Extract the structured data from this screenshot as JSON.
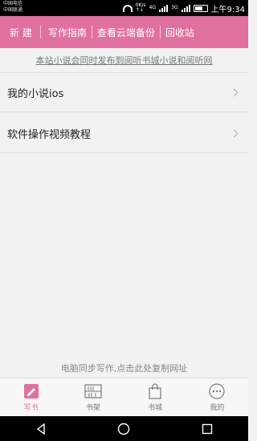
{
  "status": {
    "carrier1": "中国电信",
    "carrier2": "中国联通",
    "speed_top": "0K/s",
    "speed_bottom": "↑↓",
    "net1": "4G",
    "net2": "3G",
    "time": "上午9:34"
  },
  "topnav": {
    "items": [
      {
        "label": "新 建"
      },
      {
        "label": "写作指南"
      },
      {
        "label": "查看云端备份"
      },
      {
        "label": "回收站"
      }
    ],
    "color": "#e0709f"
  },
  "notice": "本站小说会同时发布到阅听书城小说和阅听网",
  "list": [
    {
      "label": "我的小说ios"
    },
    {
      "label": "软件操作视频教程"
    }
  ],
  "sync_text": "电脑同步写作,点击此处复制网址",
  "tabs": [
    {
      "label": "写书",
      "icon": "pen-square-icon",
      "active": true
    },
    {
      "label": "书架",
      "icon": "bookshelf-icon",
      "active": false
    },
    {
      "label": "书城",
      "icon": "shopping-bag-icon",
      "active": false
    },
    {
      "label": "我的",
      "icon": "more-icon",
      "active": false
    }
  ]
}
